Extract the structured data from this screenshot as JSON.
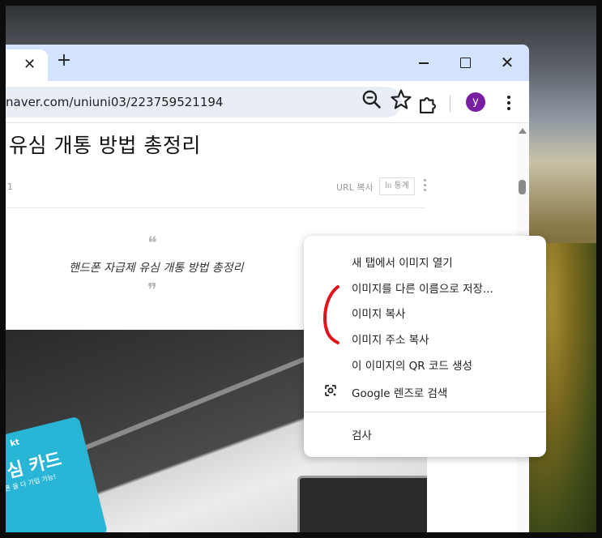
{
  "browser": {
    "tab_close_glyph": "✕",
    "new_tab_glyph": "+",
    "url": "naver.com/uniuni03/223759521194",
    "avatar_initial": "y",
    "avatar_color": "#7b1fa2",
    "close_glyph": "✕"
  },
  "post": {
    "title": "유심 개통 방법 총정리",
    "meta_number": "1",
    "url_copy_label": "URL 복사",
    "stats_label": "lıı 통계",
    "quote_open": "❝",
    "quote_text": "핸드폰 자급제 유심 개통 방법 총정리",
    "quote_close": "❞"
  },
  "photo": {
    "sim_brand": "kt",
    "sim_title": "심 카드",
    "sim_subtitle": "폰 을 다 가입 가능!"
  },
  "context_menu": {
    "items": [
      "새 탭에서 이미지 열기",
      "이미지를 다른 이름으로 저장...",
      "이미지 복사",
      "이미지 주소 복사",
      "이 이미지의 QR 코드 생성",
      "Google 렌즈로 검색",
      "검사"
    ]
  },
  "colors": {
    "tabstrip": "#d3e3fd",
    "omnibox": "#e9eef6",
    "annotation": "#e0131d"
  }
}
